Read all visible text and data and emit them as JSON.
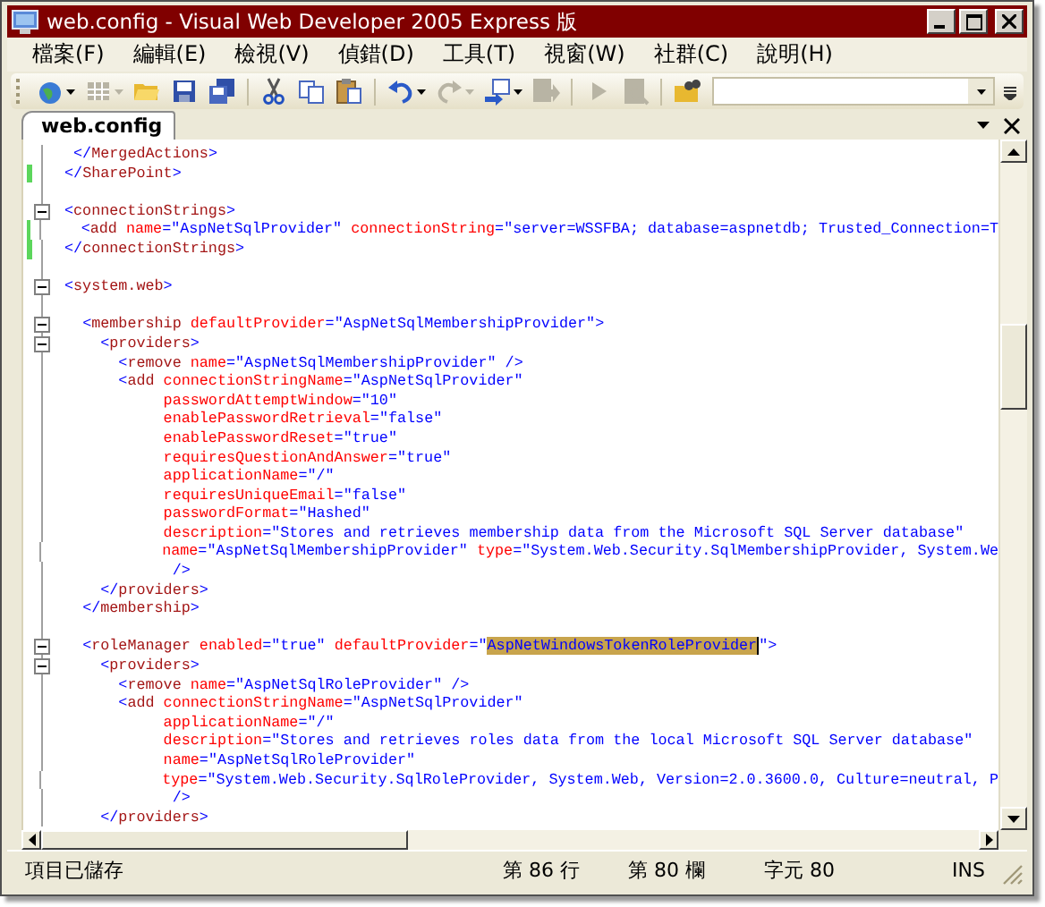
{
  "window": {
    "title": "web.config - Visual Web Developer 2005 Express 版"
  },
  "menu": [
    {
      "label": "檔案(F)"
    },
    {
      "label": "編輯(E)"
    },
    {
      "label": "檢視(V)"
    },
    {
      "label": "偵錯(D)"
    },
    {
      "label": "工具(T)"
    },
    {
      "label": "視窗(W)"
    },
    {
      "label": "社群(C)"
    },
    {
      "label": "說明(H)"
    }
  ],
  "toolbar": {
    "items": [
      {
        "kind": "globe",
        "dropdown": true,
        "disabled": false
      },
      {
        "kind": "grid",
        "dropdown": true,
        "disabled": true
      },
      {
        "kind": "folder",
        "dropdown": false,
        "disabled": false
      },
      {
        "kind": "disk",
        "dropdown": false,
        "disabled": false
      },
      {
        "kind": "disks",
        "dropdown": false,
        "disabled": false
      },
      {
        "kind": "separator"
      },
      {
        "kind": "scissors",
        "dropdown": false,
        "disabled": false
      },
      {
        "kind": "copy",
        "dropdown": false,
        "disabled": false
      },
      {
        "kind": "paste",
        "dropdown": false,
        "disabled": false
      },
      {
        "kind": "separator"
      },
      {
        "kind": "undo",
        "dropdown": true,
        "disabled": false
      },
      {
        "kind": "redo",
        "dropdown": true,
        "disabled": true
      },
      {
        "kind": "navigate",
        "dropdown": true,
        "disabled": false
      },
      {
        "kind": "export",
        "dropdown": false,
        "disabled": true
      },
      {
        "kind": "separator"
      },
      {
        "kind": "play",
        "dropdown": false,
        "disabled": true
      },
      {
        "kind": "inspect",
        "dropdown": false,
        "disabled": true
      },
      {
        "kind": "separator"
      },
      {
        "kind": "find",
        "dropdown": false,
        "disabled": false
      }
    ]
  },
  "document_tabs": [
    {
      "label": "web.config",
      "selected": true
    }
  ],
  "editor": {
    "lines": [
      {
        "kind": "code",
        "fold": false,
        "changed": false,
        "segments": [
          {
            "kind": "delimiter",
            "text": " </"
          },
          {
            "kind": "element",
            "text": "MergedActions"
          },
          {
            "kind": "delimiter",
            "text": ">"
          }
        ]
      },
      {
        "kind": "code",
        "fold": false,
        "changed": true,
        "segments": [
          {
            "kind": "delimiter",
            "text": "</"
          },
          {
            "kind": "element",
            "text": "SharePoint"
          },
          {
            "kind": "delimiter",
            "text": ">"
          }
        ]
      },
      {
        "kind": "blank"
      },
      {
        "kind": "code",
        "fold": true,
        "changed": false,
        "segments": [
          {
            "kind": "delimiter",
            "text": "<"
          },
          {
            "kind": "element",
            "text": "connectionStrings"
          },
          {
            "kind": "delimiter",
            "text": ">"
          }
        ]
      },
      {
        "kind": "code",
        "fold": false,
        "changed": true,
        "segments": [
          {
            "kind": "delimiter",
            "text": "  <"
          },
          {
            "kind": "element",
            "text": "add"
          },
          {
            "kind": "attribute",
            "text": " name"
          },
          {
            "kind": "delimiter",
            "text": "="
          },
          {
            "kind": "value",
            "text": "\"AspNetSqlProvider\""
          },
          {
            "kind": "attribute",
            "text": " connectionString"
          },
          {
            "kind": "delimiter",
            "text": "="
          },
          {
            "kind": "value",
            "text": "\"server=WSSFBA; database=aspnetdb; Trusted_Connection=T"
          }
        ]
      },
      {
        "kind": "code",
        "fold": false,
        "changed": true,
        "segments": [
          {
            "kind": "delimiter",
            "text": "</"
          },
          {
            "kind": "element",
            "text": "connectionStrings"
          },
          {
            "kind": "delimiter",
            "text": ">"
          }
        ]
      },
      {
        "kind": "blank"
      },
      {
        "kind": "code",
        "fold": true,
        "changed": false,
        "segments": [
          {
            "kind": "delimiter",
            "text": "<"
          },
          {
            "kind": "element",
            "text": "system.web"
          },
          {
            "kind": "delimiter",
            "text": ">"
          }
        ]
      },
      {
        "kind": "blank"
      },
      {
        "kind": "code",
        "fold": true,
        "changed": false,
        "segments": [
          {
            "kind": "delimiter",
            "text": "  <"
          },
          {
            "kind": "element",
            "text": "membership"
          },
          {
            "kind": "attribute",
            "text": " defaultProvider"
          },
          {
            "kind": "delimiter",
            "text": "="
          },
          {
            "kind": "value",
            "text": "\"AspNetSqlMembershipProvider\""
          },
          {
            "kind": "delimiter",
            "text": ">"
          }
        ]
      },
      {
        "kind": "code",
        "fold": true,
        "changed": false,
        "segments": [
          {
            "kind": "delimiter",
            "text": "    <"
          },
          {
            "kind": "element",
            "text": "providers"
          },
          {
            "kind": "delimiter",
            "text": ">"
          }
        ]
      },
      {
        "kind": "code",
        "fold": false,
        "changed": false,
        "segments": [
          {
            "kind": "delimiter",
            "text": "      <"
          },
          {
            "kind": "element",
            "text": "remove"
          },
          {
            "kind": "attribute",
            "text": " name"
          },
          {
            "kind": "delimiter",
            "text": "="
          },
          {
            "kind": "value",
            "text": "\"AspNetSqlMembershipProvider\""
          },
          {
            "kind": "delimiter",
            "text": " />"
          }
        ]
      },
      {
        "kind": "code",
        "fold": false,
        "changed": false,
        "segments": [
          {
            "kind": "delimiter",
            "text": "      <"
          },
          {
            "kind": "element",
            "text": "add"
          },
          {
            "kind": "attribute",
            "text": " connectionStringName"
          },
          {
            "kind": "delimiter",
            "text": "="
          },
          {
            "kind": "value",
            "text": "\"AspNetSqlProvider\""
          }
        ]
      },
      {
        "kind": "code",
        "fold": false,
        "changed": false,
        "segments": [
          {
            "kind": "attribute",
            "text": "           passwordAttemptWindow"
          },
          {
            "kind": "delimiter",
            "text": "="
          },
          {
            "kind": "value",
            "text": "\"10\""
          }
        ]
      },
      {
        "kind": "code",
        "fold": false,
        "changed": false,
        "segments": [
          {
            "kind": "attribute",
            "text": "           enablePasswordRetrieval"
          },
          {
            "kind": "delimiter",
            "text": "="
          },
          {
            "kind": "value",
            "text": "\"false\""
          }
        ]
      },
      {
        "kind": "code",
        "fold": false,
        "changed": false,
        "segments": [
          {
            "kind": "attribute",
            "text": "           enablePasswordReset"
          },
          {
            "kind": "delimiter",
            "text": "="
          },
          {
            "kind": "value",
            "text": "\"true\""
          }
        ]
      },
      {
        "kind": "code",
        "fold": false,
        "changed": false,
        "segments": [
          {
            "kind": "attribute",
            "text": "           requiresQuestionAndAnswer"
          },
          {
            "kind": "delimiter",
            "text": "="
          },
          {
            "kind": "value",
            "text": "\"true\""
          }
        ]
      },
      {
        "kind": "code",
        "fold": false,
        "changed": false,
        "segments": [
          {
            "kind": "attribute",
            "text": "           applicationName"
          },
          {
            "kind": "delimiter",
            "text": "="
          },
          {
            "kind": "value",
            "text": "\"/\""
          }
        ]
      },
      {
        "kind": "code",
        "fold": false,
        "changed": false,
        "segments": [
          {
            "kind": "attribute",
            "text": "           requiresUniqueEmail"
          },
          {
            "kind": "delimiter",
            "text": "="
          },
          {
            "kind": "value",
            "text": "\"false\""
          }
        ]
      },
      {
        "kind": "code",
        "fold": false,
        "changed": false,
        "segments": [
          {
            "kind": "attribute",
            "text": "           passwordFormat"
          },
          {
            "kind": "delimiter",
            "text": "="
          },
          {
            "kind": "value",
            "text": "\"Hashed\""
          }
        ]
      },
      {
        "kind": "code",
        "fold": false,
        "changed": false,
        "segments": [
          {
            "kind": "attribute",
            "text": "           description"
          },
          {
            "kind": "delimiter",
            "text": "="
          },
          {
            "kind": "value",
            "text": "\"Stores and retrieves membership data from the Microsoft SQL Server database\""
          }
        ]
      },
      {
        "kind": "code",
        "fold": false,
        "changed": false,
        "segments": [
          {
            "kind": "attribute",
            "text": "           name"
          },
          {
            "kind": "delimiter",
            "text": "="
          },
          {
            "kind": "value",
            "text": "\"AspNetSqlMembershipProvider\""
          },
          {
            "kind": "attribute",
            "text": " type"
          },
          {
            "kind": "delimiter",
            "text": "="
          },
          {
            "kind": "value",
            "text": "\"System.Web.Security.SqlMembershipProvider, System.We"
          }
        ]
      },
      {
        "kind": "code",
        "fold": false,
        "changed": false,
        "segments": [
          {
            "kind": "delimiter",
            "text": "            />"
          }
        ]
      },
      {
        "kind": "code",
        "fold": false,
        "changed": false,
        "segments": [
          {
            "kind": "delimiter",
            "text": "    </"
          },
          {
            "kind": "element",
            "text": "providers"
          },
          {
            "kind": "delimiter",
            "text": ">"
          }
        ]
      },
      {
        "kind": "code",
        "fold": false,
        "changed": false,
        "segments": [
          {
            "kind": "delimiter",
            "text": "  </"
          },
          {
            "kind": "element",
            "text": "membership"
          },
          {
            "kind": "delimiter",
            "text": ">"
          }
        ]
      },
      {
        "kind": "blank"
      },
      {
        "kind": "code",
        "fold": true,
        "changed": false,
        "segments": [
          {
            "kind": "delimiter",
            "text": "  <"
          },
          {
            "kind": "element",
            "text": "roleManager"
          },
          {
            "kind": "attribute",
            "text": " enabled"
          },
          {
            "kind": "delimiter",
            "text": "="
          },
          {
            "kind": "value",
            "text": "\"true\""
          },
          {
            "kind": "attribute",
            "text": " defaultProvider"
          },
          {
            "kind": "delimiter",
            "text": "="
          },
          {
            "kind": "value",
            "text": "\""
          },
          {
            "kind": "selection",
            "text": "AspNetWindowsTokenRoleProvider"
          },
          {
            "kind": "value",
            "text": "\""
          },
          {
            "kind": "delimiter",
            "text": ">"
          }
        ]
      },
      {
        "kind": "code",
        "fold": true,
        "changed": false,
        "segments": [
          {
            "kind": "delimiter",
            "text": "    <"
          },
          {
            "kind": "element",
            "text": "providers"
          },
          {
            "kind": "delimiter",
            "text": ">"
          }
        ]
      },
      {
        "kind": "code",
        "fold": false,
        "changed": false,
        "segments": [
          {
            "kind": "delimiter",
            "text": "      <"
          },
          {
            "kind": "element",
            "text": "remove"
          },
          {
            "kind": "attribute",
            "text": " name"
          },
          {
            "kind": "delimiter",
            "text": "="
          },
          {
            "kind": "value",
            "text": "\"AspNetSqlRoleProvider\""
          },
          {
            "kind": "delimiter",
            "text": " />"
          }
        ]
      },
      {
        "kind": "code",
        "fold": false,
        "changed": false,
        "segments": [
          {
            "kind": "delimiter",
            "text": "      <"
          },
          {
            "kind": "element",
            "text": "add"
          },
          {
            "kind": "attribute",
            "text": " connectionStringName"
          },
          {
            "kind": "delimiter",
            "text": "="
          },
          {
            "kind": "value",
            "text": "\"AspNetSqlProvider\""
          }
        ]
      },
      {
        "kind": "code",
        "fold": false,
        "changed": false,
        "segments": [
          {
            "kind": "attribute",
            "text": "           applicationName"
          },
          {
            "kind": "delimiter",
            "text": "="
          },
          {
            "kind": "value",
            "text": "\"/\""
          }
        ]
      },
      {
        "kind": "code",
        "fold": false,
        "changed": false,
        "segments": [
          {
            "kind": "attribute",
            "text": "           description"
          },
          {
            "kind": "delimiter",
            "text": "="
          },
          {
            "kind": "value",
            "text": "\"Stores and retrieves roles data from the local Microsoft SQL Server database\""
          }
        ]
      },
      {
        "kind": "code",
        "fold": false,
        "changed": false,
        "segments": [
          {
            "kind": "attribute",
            "text": "           name"
          },
          {
            "kind": "delimiter",
            "text": "="
          },
          {
            "kind": "value",
            "text": "\"AspNetSqlRoleProvider\""
          }
        ]
      },
      {
        "kind": "code",
        "fold": false,
        "changed": false,
        "segments": [
          {
            "kind": "attribute",
            "text": "           type"
          },
          {
            "kind": "delimiter",
            "text": "="
          },
          {
            "kind": "value",
            "text": "\"System.Web.Security.SqlRoleProvider, System.Web, Version=2.0.3600.0, Culture=neutral, P"
          }
        ]
      },
      {
        "kind": "code",
        "fold": false,
        "changed": false,
        "segments": [
          {
            "kind": "delimiter",
            "text": "            />"
          }
        ]
      },
      {
        "kind": "code",
        "fold": false,
        "changed": false,
        "segments": [
          {
            "kind": "delimiter",
            "text": "    </"
          },
          {
            "kind": "element",
            "text": "providers"
          },
          {
            "kind": "delimiter",
            "text": ">"
          }
        ]
      }
    ]
  },
  "status_bar": {
    "message": "項目已儲存",
    "line": "第 86 行",
    "column": "第 80 欄",
    "character": "字元 80",
    "mode": "INS"
  }
}
